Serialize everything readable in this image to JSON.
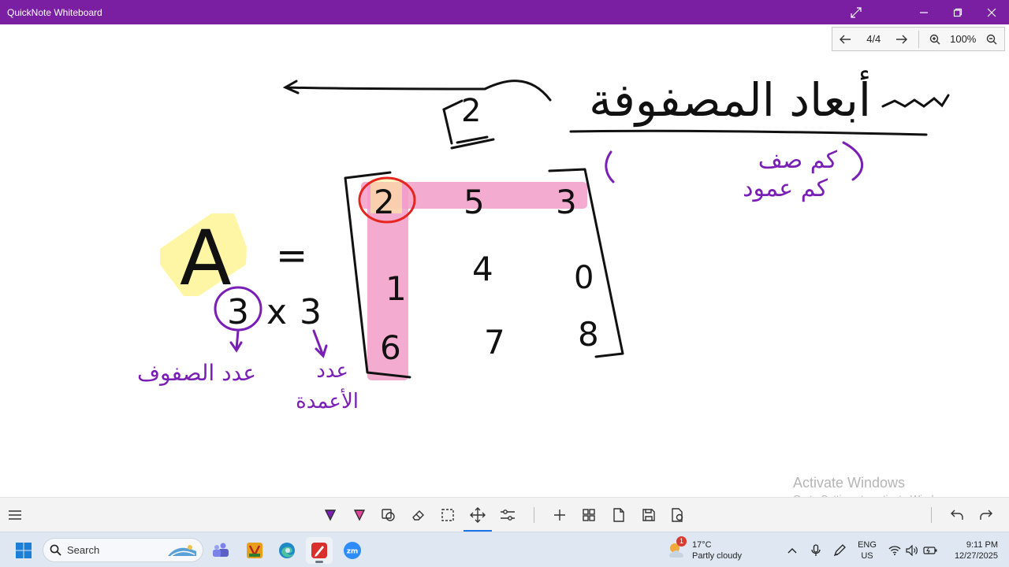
{
  "window": {
    "title": "QuickNote Whiteboard"
  },
  "pager": {
    "page": "4/4",
    "zoom": "100%"
  },
  "board": {
    "matrix_name": "A",
    "equals": "=",
    "rows_count": "3",
    "times": "x",
    "cols_count": "3",
    "matrix": [
      [
        "2",
        "5",
        "3"
      ],
      [
        "1",
        "4",
        "0"
      ],
      [
        "6",
        "7",
        "8"
      ]
    ],
    "heading_ar": "أبعاد المصفوفة",
    "note_dimension": "2",
    "note_line1": "كم صف",
    "note_line2": "كم عمود",
    "label_rows": "عدد الصفوف",
    "label_cols_1": "عدد",
    "label_cols_2": "الأعمدة",
    "ink_colors": {
      "black": "#111111",
      "purple": "#7a1fb5",
      "red": "#e52620",
      "pink": "#f29cc8",
      "yellow": "#fff59b"
    }
  },
  "watermark": {
    "line1": "Activate Windows",
    "line2": "Go to Settings to activate Windows."
  },
  "toolbar": {
    "tools": [
      "menu-icon",
      "pen-purple-icon",
      "highlighter-icon",
      "shapes-icon",
      "eraser-icon",
      "lasso-select-icon",
      "pan-icon",
      "settings-sliders-icon",
      "add-page-icon",
      "grid-icon",
      "page-icon",
      "save-icon",
      "export-icon",
      "undo-icon",
      "redo-icon"
    ]
  },
  "taskbar": {
    "search_placeholder": "Search",
    "weather_temp": "17°C",
    "weather_desc": "Partly cloudy",
    "weather_badge": "1",
    "lang_1": "ENG",
    "lang_2": "US",
    "time": "9:11 PM",
    "date": "12/27/2025"
  }
}
